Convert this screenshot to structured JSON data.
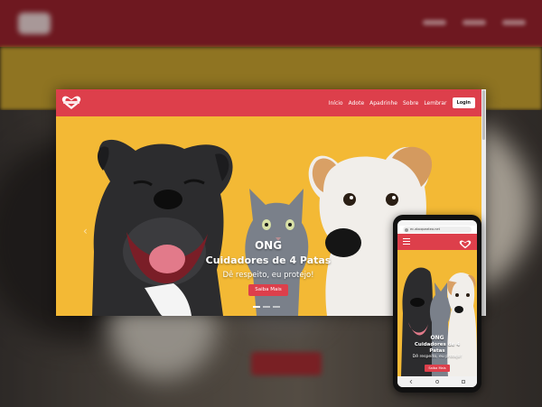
{
  "site": {
    "nav": [
      "Início",
      "Adote",
      "Apadrinhe",
      "Sobre",
      "Lembrar"
    ],
    "login_label": "Login",
    "hero": {
      "ong": "ONG",
      "title": "Cuidadores de 4 Patas",
      "subtitle": "Dê respeito, eu protejo!",
      "cta_label": "Saiba Mais"
    }
  },
  "phone": {
    "url": "ec.aboqueatea.net",
    "hero": {
      "ong": "ONG",
      "title_line1": "Cuidadores de 4",
      "title_line2": "Patas",
      "subtitle": "Dê respeito, eu protejo!",
      "cta_label": "Saiba Mais"
    }
  },
  "colors": {
    "brand_red": "#dd3f4b",
    "hero_yellow": "#f3b935",
    "backdrop_red": "#8d1f29"
  },
  "icons": [
    "heart-logo-icon",
    "hamburger-menu-icon",
    "chevron-left-icon",
    "chevron-right-icon",
    "lock-icon"
  ]
}
